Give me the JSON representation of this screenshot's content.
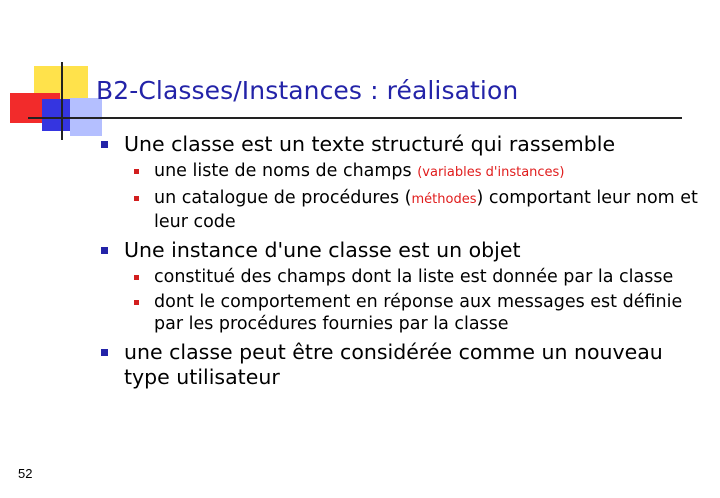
{
  "title": "B2-Classes/Instances : réalisation",
  "page_number": "52",
  "bullets": {
    "b1": {
      "text": "Une classe est un texte structuré qui rassemble",
      "sub1": {
        "pre": "une liste de noms de champs ",
        "open": "(",
        "red": "variables d'instances",
        "close": ")"
      },
      "sub2": {
        "pre": "un catalogue de procédures (",
        "red": "méthodes",
        "post": ") comportant leur nom et leur code"
      }
    },
    "b2": {
      "text": "Une instance d'une classe est un objet",
      "sub1": "constitué des champs dont la liste est donnée par la classe",
      "sub2": "dont le comportement en réponse aux messages est définie par les procédures fournies par la classe"
    },
    "b3": {
      "text": "une classe peut être considérée comme un nouveau type utilisateur"
    }
  },
  "colors": {
    "title": "#2323A8",
    "bullet_level1": "#2323A8",
    "bullet_level2": "#D21E1E",
    "highlight_text": "#E01C1C",
    "deco_yellow": "#FFE24B",
    "deco_red": "#F22B2B",
    "deco_blue": "#3535E0",
    "deco_lavender": "#B4BFFF"
  }
}
